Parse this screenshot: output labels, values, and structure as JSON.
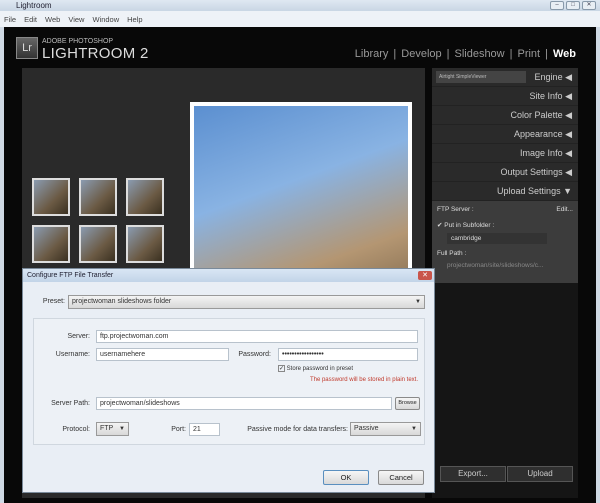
{
  "window": {
    "title": "Lightroom",
    "controls": [
      "–",
      "□",
      "✕"
    ]
  },
  "menu": [
    "File",
    "Edit",
    "Web",
    "View",
    "Window",
    "Help"
  ],
  "brand": {
    "logo": "Lr",
    "adobe": "ADOBE PHOTOSHOP",
    "product": "LIGHTROOM 2"
  },
  "modules": [
    "Library",
    "Develop",
    "Slideshow",
    "Print",
    "Web"
  ],
  "right_panel": {
    "engine_select": "Airtight SimpleViewer",
    "panels": [
      "Engine",
      "Site Info",
      "Color Palette",
      "Appearance",
      "Image Info",
      "Output Settings",
      "Upload Settings"
    ],
    "ftp_server_label": "FTP Server :",
    "edit_label": "Edit...",
    "subfolder_label": "Put in Subfolder :",
    "subfolder_value": "cambridge",
    "full_path_label": "Full Path :",
    "full_path_value": "projectwoman/site/slideshows/c..."
  },
  "bottom": {
    "export": "Export...",
    "upload": "Upload"
  },
  "dialog": {
    "title": "Configure FTP File Transfer",
    "preset_label": "Preset:",
    "preset_value": "projectwoman slideshows folder",
    "server_label": "Server:",
    "server_value": "ftp.projectwoman.com",
    "username_label": "Username:",
    "username_value": "usernamehere",
    "password_label": "Password:",
    "password_value": "•••••••••••••••••",
    "store_password_label": "Store password in preset",
    "warning": "The password will be stored in plain text.",
    "server_path_label": "Server Path:",
    "server_path_value": "projectwoman/slideshows",
    "browse": "Browse",
    "protocol_label": "Protocol:",
    "protocol_value": "FTP",
    "port_label": "Port:",
    "port_value": "21",
    "passive_label": "Passive mode for data transfers:",
    "passive_value": "Passive",
    "ok": "OK",
    "cancel": "Cancel"
  }
}
